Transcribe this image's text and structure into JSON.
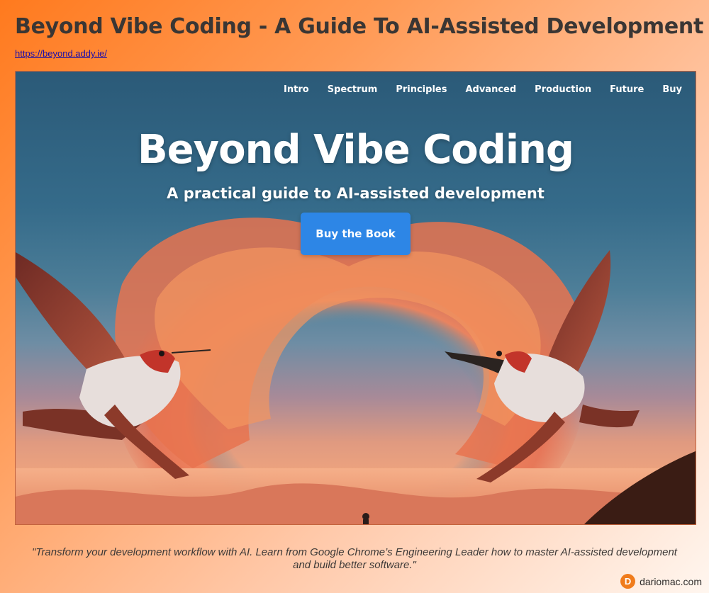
{
  "page": {
    "title": "Beyond Vibe Coding - A Guide To AI-Assisted Development",
    "url": "https://beyond.addy.ie/"
  },
  "site": {
    "nav": [
      "Intro",
      "Spectrum",
      "Principles",
      "Advanced",
      "Production",
      "Future",
      "Buy"
    ],
    "hero_title": "Beyond Vibe Coding",
    "hero_subtitle": "A practical guide to AI-assisted development",
    "cta_label": "Buy the Book"
  },
  "quote": "\"Transform your development workflow with AI. Learn from Google Chrome’s Engineering Leader how to master AI-assisted development and build better software.\"",
  "brand": {
    "logo_letter": "D",
    "name": "dariomac.com"
  },
  "colors": {
    "accent": "#2d86e6",
    "brand_orange": "#f07c1c",
    "background_start": "#ff7a1e"
  },
  "icons": {
    "brand_logo": "dariomac-logo-icon"
  }
}
